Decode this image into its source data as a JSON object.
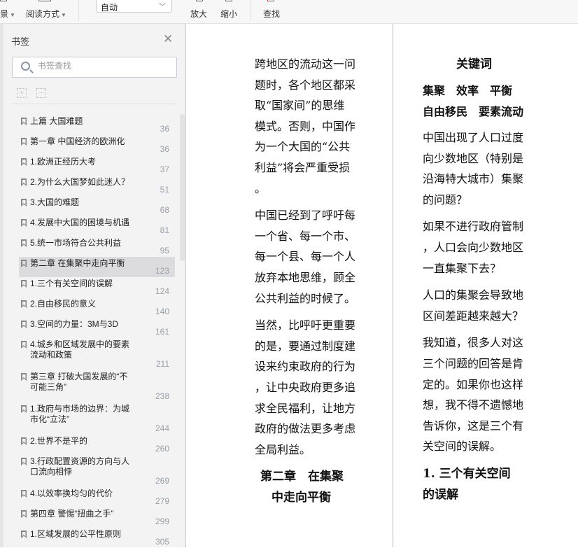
{
  "toolbar": {
    "view_label": "景",
    "reading_mode": "阅读方式",
    "zoom_value": "自动",
    "zoom_in": "放大",
    "zoom_out": "缩小",
    "find": "查找"
  },
  "sidebar": {
    "title": "书签",
    "search_placeholder": "书签查找",
    "items": [
      {
        "label": "上篇 大国难题",
        "page": "36"
      },
      {
        "label": "第一章 中国经济的欧洲化",
        "page": "36"
      },
      {
        "label": "1.欧洲正经历大考",
        "page": "37"
      },
      {
        "label": "2.为什么大国梦如此迷人？",
        "page": "51"
      },
      {
        "label": "3.大国的难题",
        "page": "68"
      },
      {
        "label": "4.发展中大国的困境与机遇",
        "page": "81"
      },
      {
        "label": "5.统一市场符合公共利益",
        "page": "95"
      },
      {
        "label": "第二章 在集聚中走向平衡",
        "page": "123",
        "selected": true
      },
      {
        "label": "1.三个有关空间的误解",
        "page": "124"
      },
      {
        "label": "2.自由移民的意义",
        "page": "140"
      },
      {
        "label": "3.空间的力量：3M与3D",
        "page": "161"
      },
      {
        "label": "4.城乡和区域发展中的要素流动和政策",
        "page": "211",
        "two": true
      },
      {
        "label": "第三章 打破大国发展的“不可能三角”",
        "page": "238",
        "two": true
      },
      {
        "label": "1.政府与市场的边界：为城市化“立法”",
        "page": "244",
        "two": true
      },
      {
        "label": "2.世界不是平的",
        "page": "260"
      },
      {
        "label": "3.行政配置资源的方向与人口流向相悖",
        "page": "269",
        "two": true
      },
      {
        "label": "4.以效率换均匀的代价",
        "page": "279"
      },
      {
        "label": "第四章 警惕“扭曲之手”",
        "page": "299"
      },
      {
        "label": "1.区域发展的公平性原则",
        "page": "305"
      }
    ]
  },
  "page_left": {
    "paragraphs": [
      [
        "跨地区的流动这一问",
        "题时，各个地区都采",
        "取“国家间”的思维",
        "模式。否则，中国作",
        "为一个大国的“公共",
        "利益”将会严重受损",
        "。"
      ],
      [
        "中国已经到了呼吁每",
        "一个省、每一个市、",
        "每一个县、每一个人",
        "放弃本地思维，顾全",
        "公共利益的时候了。"
      ],
      [
        "当然，比呼吁更重要",
        "的是，要通过制度建",
        "设来约束政府的行为",
        "，让中央政府更多追",
        "求全民福利，让地方",
        "政府的做法更多考虑",
        "全局利益。"
      ]
    ],
    "heading": [
      "第二章　在集聚",
      "中走向平衡"
    ]
  },
  "page_right": {
    "keywords_title": "关键词",
    "keywords": [
      "集聚　效率　平衡",
      "自由移民　要素流动"
    ],
    "paragraphs": [
      [
        "中国出现了人口过度",
        "向少数地区（特别是",
        "沿海特大城市）集聚",
        "的问题？"
      ],
      [
        "如果不进行政府管制",
        "，人口会向少数地区",
        "一直集聚下去？"
      ],
      [
        "人口的集聚会导致地",
        "区间差距越来越大？"
      ],
      [
        "我知道，很多人对这",
        "三个问题的回答是肯",
        "定的。如果你也这样",
        "想，我不得不遗憾地",
        "告诉你，这是三个有",
        "关空间的误解。"
      ]
    ],
    "heading": [
      "1. 三个有关空间",
      "的误解"
    ]
  }
}
